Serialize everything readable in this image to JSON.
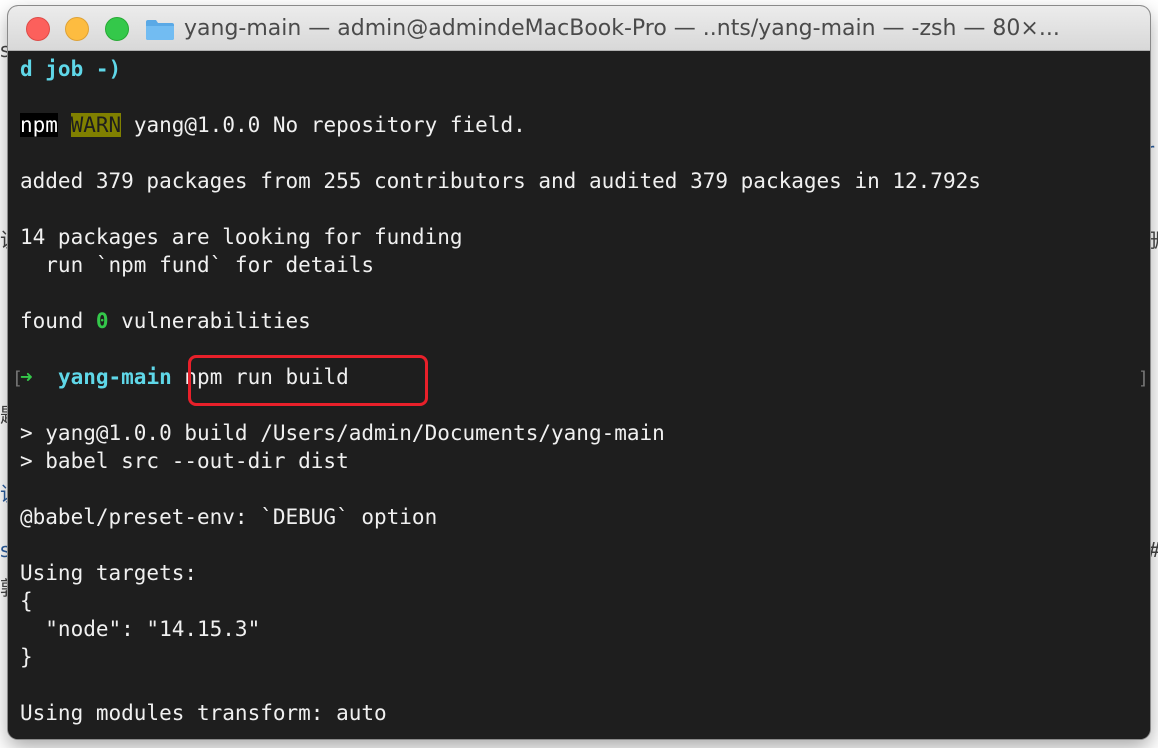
{
  "window": {
    "title": "yang-main — admin@admindeMacBook-Pro — ..nts/yang-main — -zsh — 80×..."
  },
  "background": {
    "frag_s": "s",
    "frag_1": "说",
    "frag_2": "题",
    "frag_3": "说",
    "frag_4": "se",
    "frag_5": "郭",
    "frag_r1": "r",
    "frag_r2": "册",
    "frag_r3": "#"
  },
  "terminal": {
    "line_job": "d job -)",
    "warn_npm": "npm",
    "warn_tag": "WARN",
    "warn_msg": " yang@1.0.0 No repository field.",
    "added": "added 379 packages from 255 contributors and audited 379 packages in 12.792s",
    "funding_1": "14 packages are looking for funding",
    "funding_2": "  run `npm fund` for details",
    "found_pre": "found ",
    "found_num": "0",
    "found_post": " vulnerabilities",
    "prompt_bracket_left": "[",
    "prompt_arrow": "➜",
    "prompt_dir": "yang-main",
    "prompt_cmd": "npm run build",
    "prompt_bracket_right": "]",
    "script_1": "> yang@1.0.0 build /Users/admin/Documents/yang-main",
    "script_2": "> babel src --out-dir dist",
    "babel_debug": "@babel/preset-env: `DEBUG` option",
    "targets_label": "Using targets:",
    "brace_open": "{",
    "node_target": "  \"node\": \"14.15.3\"",
    "brace_close": "}",
    "modules": "Using modules transform: auto"
  },
  "colors": {
    "terminal_bg": "#1e1e1e",
    "prompt_cyan": "#5fd7e8",
    "prompt_green": "#34c84a",
    "warn_bg": "#808000",
    "highlight_box": "#e8202a"
  },
  "icons": {
    "title_icon": "folder-icon",
    "prompt_icon": "arrow-icon"
  }
}
